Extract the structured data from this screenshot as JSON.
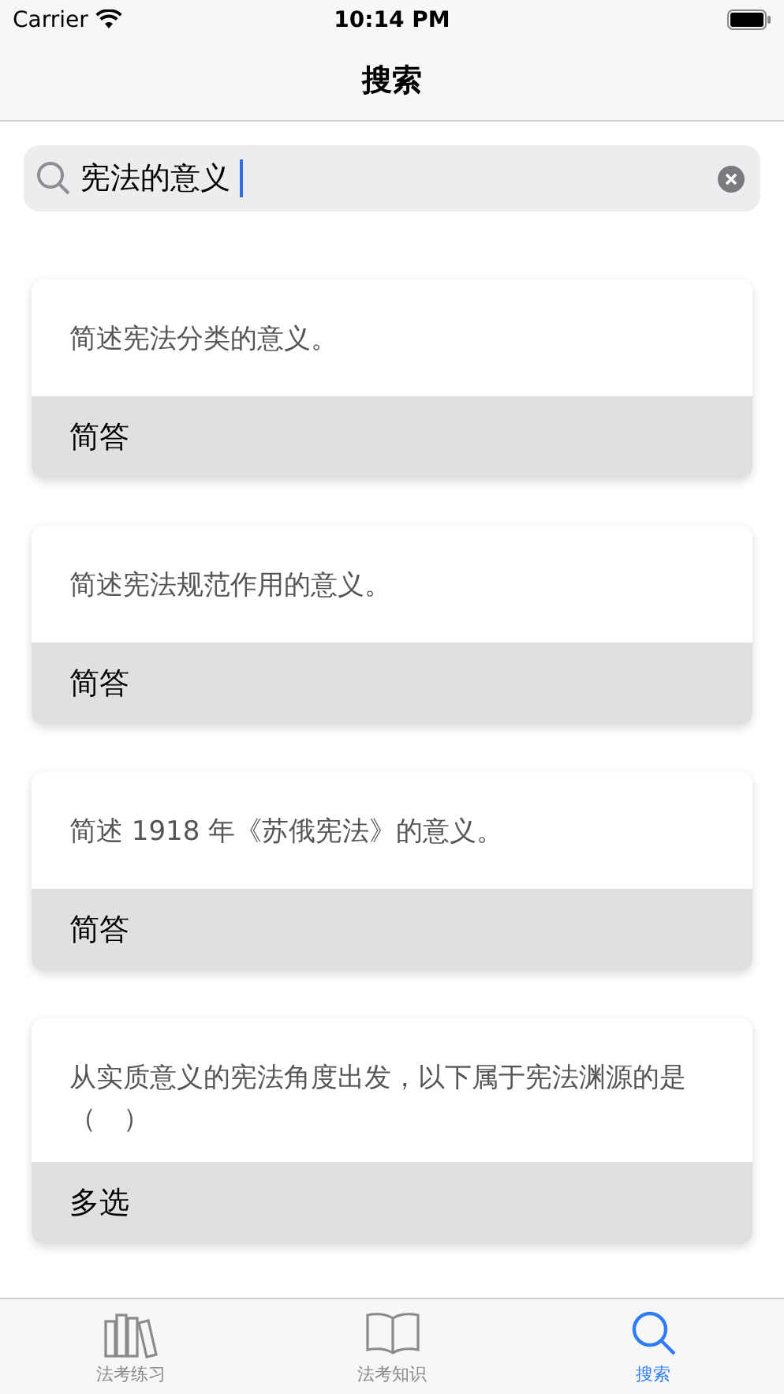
{
  "status_bar": {
    "carrier": "Carrier",
    "time": "10:14 PM"
  },
  "nav": {
    "title": "搜索"
  },
  "search": {
    "value": "宪法的意义"
  },
  "results": [
    {
      "question": "简述宪法分类的意义。",
      "type": "简答"
    },
    {
      "question": "简述宪法规范作用的意义。",
      "type": "简答"
    },
    {
      "question": "简述 1918 年《苏俄宪法》的意义。",
      "type": "简答"
    },
    {
      "question": "从实质意义的宪法角度出发，以下属于宪法渊源的是（　）",
      "type": "多选"
    }
  ],
  "tabs": [
    {
      "label": "法考练习",
      "selected": false
    },
    {
      "label": "法考知识",
      "selected": false
    },
    {
      "label": "搜索",
      "selected": true
    }
  ]
}
